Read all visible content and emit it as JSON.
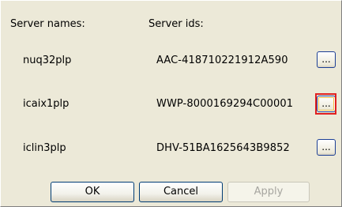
{
  "headers": {
    "names": "Server names:",
    "ids": "Server ids:"
  },
  "rows": [
    {
      "name": "nuq32plp",
      "id": "AAC-418710221912A590",
      "browse_label": "..."
    },
    {
      "name": "icaix1plp",
      "id": "WWP-8000169294C00001",
      "browse_label": "...",
      "highlighted": true
    },
    {
      "name": "iclin3plp",
      "id": "DHV-51BA1625643B9852",
      "browse_label": "..."
    }
  ],
  "buttons": {
    "ok": "OK",
    "cancel": "Cancel",
    "apply": "Apply",
    "apply_enabled": false
  },
  "colors": {
    "panel_bg": "#ece9d8",
    "highlight": "#e02020"
  }
}
